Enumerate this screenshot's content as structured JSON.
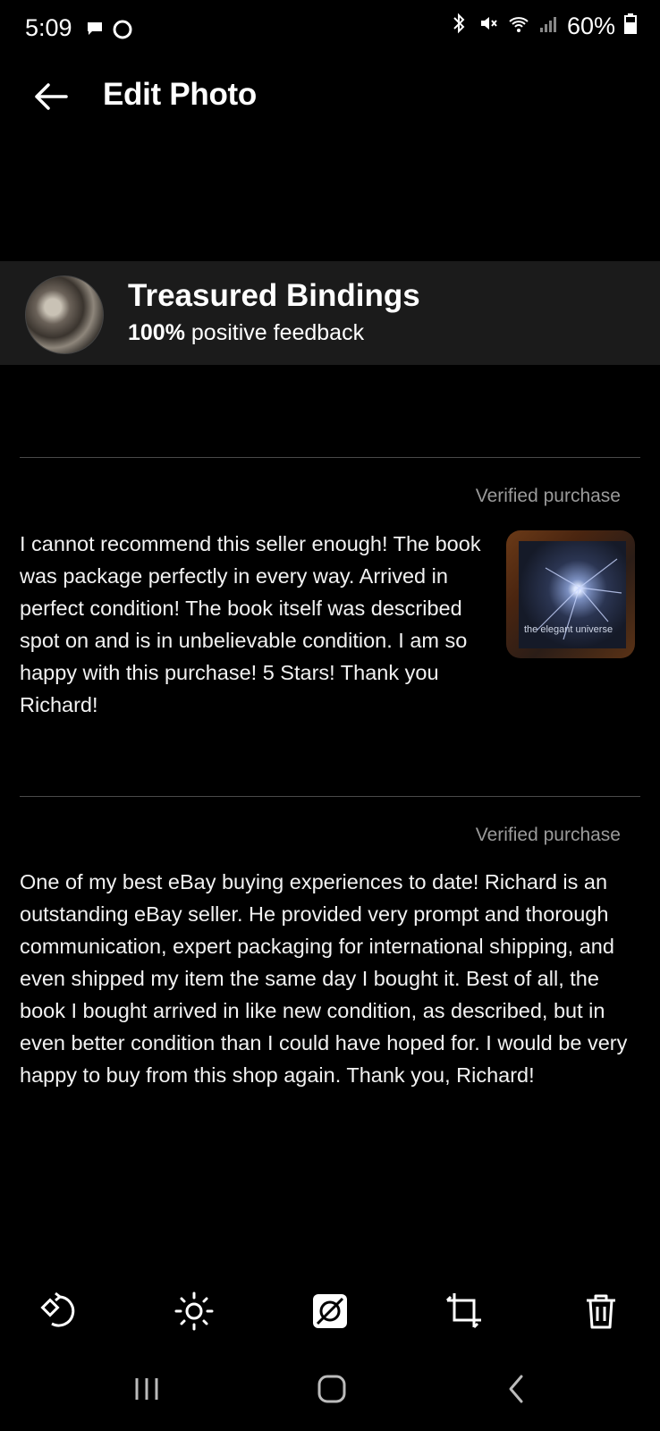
{
  "status_bar": {
    "time": "5:09",
    "battery": "60%",
    "left_icons": [
      "chat-bubble-icon",
      "circle-icon"
    ],
    "right_icons": [
      "bluetooth-icon",
      "mute-icon",
      "wifi-icon",
      "signal-icon",
      "battery-icon"
    ]
  },
  "header": {
    "title": "Edit Photo",
    "back_icon": "back-arrow-icon"
  },
  "seller": {
    "name": "Treasured Bindings",
    "feedback_percent": "100%",
    "feedback_suffix": "positive feedback"
  },
  "reviews": [
    {
      "verified": "Verified purchase",
      "text": "I cannot recommend this seller enough! The book was package perfectly in every way. Arrived in perfect condition! The book itself was described spot on and is in unbelievable condition. I am so happy with this purchase! 5 Stars! Thank you Richard!",
      "photo_text": "the elegant universe"
    },
    {
      "verified": "Verified purchase",
      "text": "One of my best eBay buying experiences to date! Richard is an outstanding eBay seller. He provided very prompt and thorough communication, expert packaging for international shipping, and even shipped my item the same day I bought it. Best of all, the book I bought arrived in like new condition, as described, but in even better condition than I could have hoped for. I would be very happy to buy from this shop again. Thank you, Richard!"
    }
  ],
  "toolbar": [
    "rotate-icon",
    "brightness-icon",
    "filter-off-icon",
    "crop-icon",
    "trash-icon"
  ],
  "nav": [
    "recents-icon",
    "home-icon",
    "back-icon"
  ]
}
